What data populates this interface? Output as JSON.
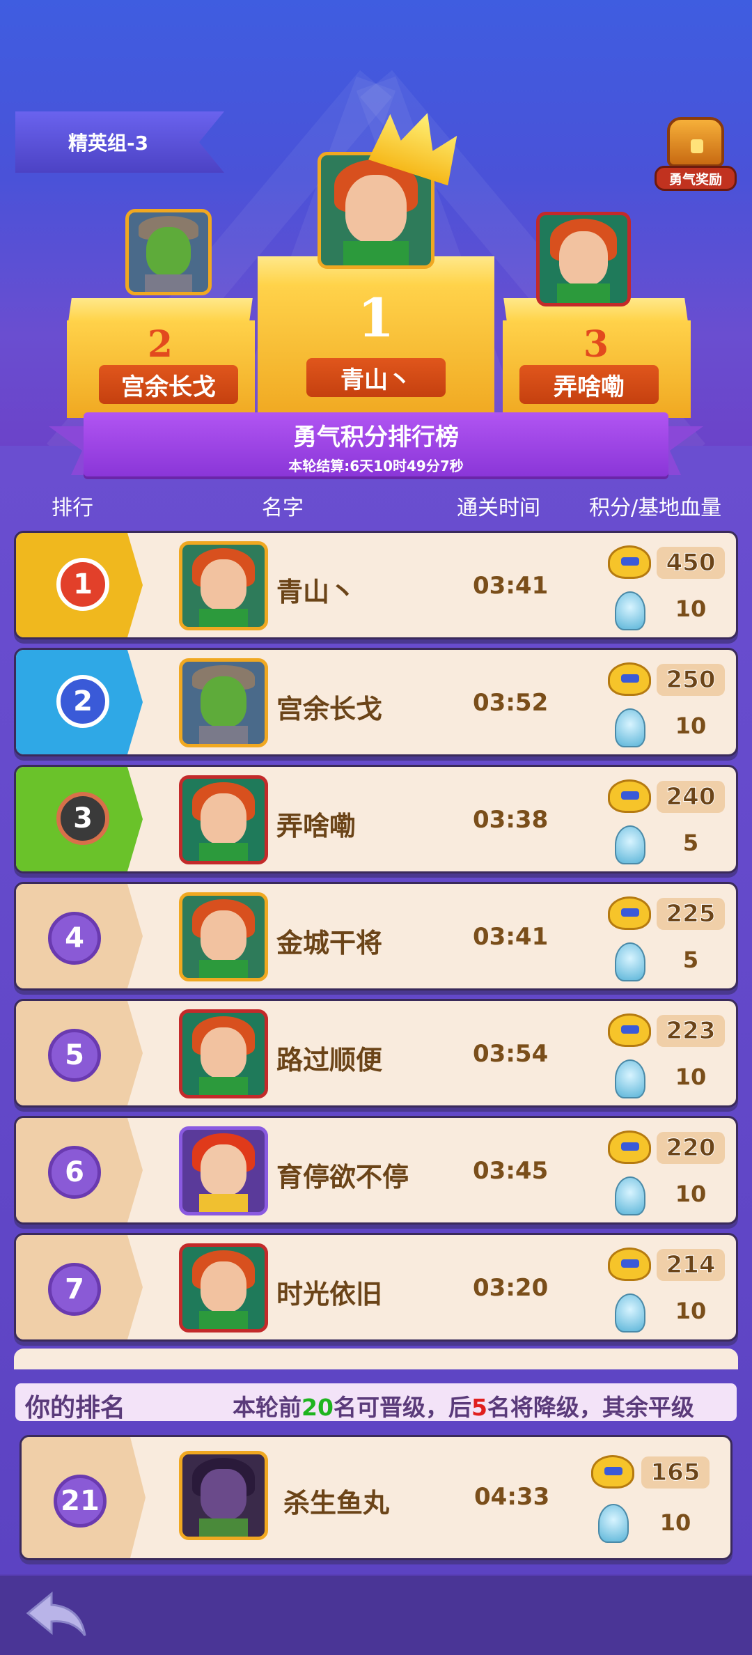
{
  "header": {
    "group_label": "精英组-3",
    "reward_label": "勇气奖励"
  },
  "podium": {
    "first": {
      "rank": "1",
      "name": "青山丶"
    },
    "second": {
      "rank": "2",
      "name": "宫余长戈"
    },
    "third": {
      "rank": "3",
      "name": "弄啥嘞"
    }
  },
  "leaderboard": {
    "title": "勇气积分排行榜",
    "countdown": "本轮结算:6天10时49分7秒"
  },
  "columns": {
    "rank": "排行",
    "name": "名字",
    "time": "通关时间",
    "score": "积分/基地血量"
  },
  "rows": [
    {
      "rank": "1",
      "name": "青山丶",
      "time": "03:41",
      "score": "450",
      "hp": "10"
    },
    {
      "rank": "2",
      "name": "宫余长戈",
      "time": "03:52",
      "score": "250",
      "hp": "10"
    },
    {
      "rank": "3",
      "name": "弄啥嘞",
      "time": "03:38",
      "score": "240",
      "hp": "5"
    },
    {
      "rank": "4",
      "name": "金城干将",
      "time": "03:41",
      "score": "225",
      "hp": "5"
    },
    {
      "rank": "5",
      "name": "路过顺便",
      "time": "03:54",
      "score": "223",
      "hp": "10"
    },
    {
      "rank": "6",
      "name": "育停欲不停",
      "time": "03:45",
      "score": "220",
      "hp": "10"
    },
    {
      "rank": "7",
      "name": "时光依旧",
      "time": "03:20",
      "score": "214",
      "hp": "10"
    }
  ],
  "my_rank": {
    "label": "你的排名",
    "rule_prefix": "本轮前",
    "promote_count": "20",
    "rule_middle": "名可晋级，后",
    "demote_count": "5",
    "rule_suffix": "名将降级，其余平级",
    "rank": "21",
    "name": "杀生鱼丸",
    "time": "04:33",
    "score": "165",
    "hp": "10"
  },
  "colors": {
    "gold_tab": "#f0b81e",
    "silver_tab": "#2fa8e6",
    "bronze_tab": "#6ac22a",
    "plain_tab": "#f0cfa8"
  }
}
